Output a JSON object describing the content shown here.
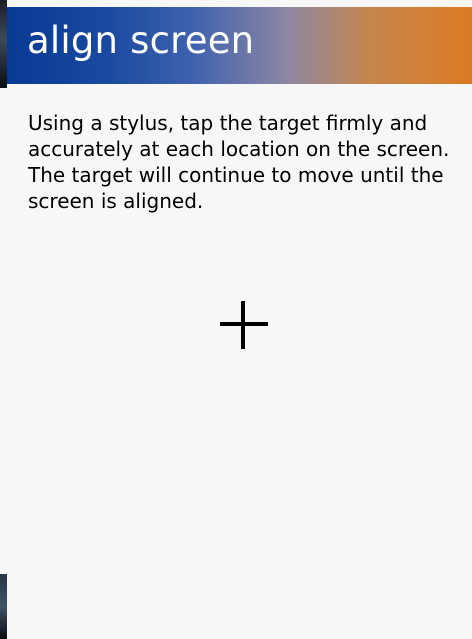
{
  "window": {
    "title": "align screen"
  },
  "main": {
    "instructions": "Using a stylus, tap the target firmly and accurately at each location on the screen. The target will continue to move until the screen is aligned."
  },
  "icons": {
    "target": "crosshair-target-icon"
  },
  "colors": {
    "title_gradient_start": "#083a94",
    "title_gradient_end": "#dc7a23",
    "background": "#f7f7f7",
    "text": "#000000"
  }
}
